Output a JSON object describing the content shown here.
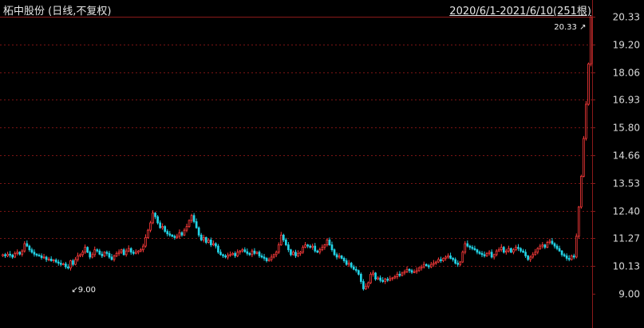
{
  "header": {
    "title": "柘中股份 (日线,不复权)",
    "range_label": "2020/6/1-2021/6/10(251根)"
  },
  "colors": {
    "up": "#ff3b3b",
    "down": "#22d3e6",
    "grid": "#7a1414",
    "axis": "#8b1a1a",
    "text": "#d9d9d9"
  },
  "chart_data": {
    "type": "candlestick",
    "title": "柘中股份 (日线,不复权)",
    "x_range": "2020/6/1-2021/6/10",
    "bar_count": 251,
    "ylim": [
      9.0,
      20.33
    ],
    "y_ticks": [
      "20.33",
      "19.20",
      "18.06",
      "16.93",
      "15.80",
      "14.66",
      "13.53",
      "12.40",
      "11.27",
      "10.13",
      "9.00"
    ],
    "annotations": {
      "max_label": "20.33",
      "min_label": "9.00"
    },
    "close": [
      10.6,
      10.55,
      10.62,
      10.58,
      10.5,
      10.65,
      10.7,
      10.62,
      10.75,
      11.05,
      10.95,
      10.8,
      10.7,
      10.62,
      10.58,
      10.55,
      10.48,
      10.5,
      10.4,
      10.42,
      10.35,
      10.38,
      10.3,
      10.25,
      10.2,
      10.22,
      10.1,
      10.05,
      10.35,
      10.2,
      10.4,
      10.55,
      10.6,
      10.7,
      10.9,
      10.7,
      10.5,
      10.6,
      10.8,
      10.75,
      10.62,
      10.55,
      10.7,
      10.65,
      10.5,
      10.4,
      10.55,
      10.65,
      10.7,
      10.8,
      10.6,
      10.75,
      10.85,
      10.7,
      10.65,
      10.7,
      10.75,
      10.8,
      10.95,
      11.3,
      11.6,
      11.9,
      12.3,
      12.15,
      11.9,
      11.7,
      11.75,
      11.55,
      11.45,
      11.4,
      11.35,
      11.3,
      11.35,
      11.5,
      11.4,
      11.6,
      11.75,
      12.0,
      12.2,
      11.95,
      11.7,
      11.4,
      11.2,
      11.3,
      11.1,
      11.2,
      11.0,
      11.05,
      10.95,
      10.7,
      10.6,
      10.55,
      10.5,
      10.58,
      10.6,
      10.65,
      10.55,
      10.7,
      10.75,
      10.8,
      10.72,
      10.65,
      10.6,
      10.75,
      10.65,
      10.7,
      10.55,
      10.5,
      10.45,
      10.35,
      10.4,
      10.5,
      10.6,
      10.7,
      11.0,
      11.4,
      11.2,
      11.0,
      10.8,
      10.6,
      10.7,
      10.55,
      10.65,
      10.7,
      10.9,
      11.0,
      10.95,
      10.9,
      10.95,
      10.75,
      10.7,
      10.8,
      10.9,
      11.0,
      11.2,
      11.0,
      10.8,
      10.6,
      10.5,
      10.55,
      10.45,
      10.35,
      10.2,
      10.25,
      10.1,
      10.0,
      9.95,
      9.8,
      9.5,
      9.2,
      9.3,
      9.45,
      9.8,
      9.85,
      9.6,
      9.65,
      9.55,
      9.5,
      9.6,
      9.55,
      9.62,
      9.65,
      9.7,
      9.8,
      9.75,
      9.85,
      9.9,
      10.0,
      9.95,
      9.88,
      9.9,
      9.95,
      10.05,
      10.1,
      10.2,
      10.15,
      10.1,
      10.2,
      10.25,
      10.3,
      10.4,
      10.35,
      10.45,
      10.5,
      10.55,
      10.45,
      10.4,
      10.25,
      10.2,
      10.3,
      10.7,
      11.05,
      10.95,
      10.9,
      10.85,
      10.8,
      10.7,
      10.65,
      10.6,
      10.55,
      10.65,
      10.7,
      10.5,
      10.6,
      10.75,
      10.8,
      10.9,
      10.7,
      10.75,
      10.85,
      10.7,
      10.8,
      10.9,
      10.85,
      10.75,
      10.7,
      10.55,
      10.4,
      10.5,
      10.6,
      10.7,
      10.85,
      10.95,
      11.0,
      10.9,
      11.1,
      11.15,
      11.05,
      10.95,
      10.85,
      10.75,
      10.6,
      10.55,
      10.45,
      10.4,
      10.55,
      10.5,
      11.35,
      12.55,
      13.8,
      15.35,
      16.75,
      18.4,
      20.33
    ]
  }
}
